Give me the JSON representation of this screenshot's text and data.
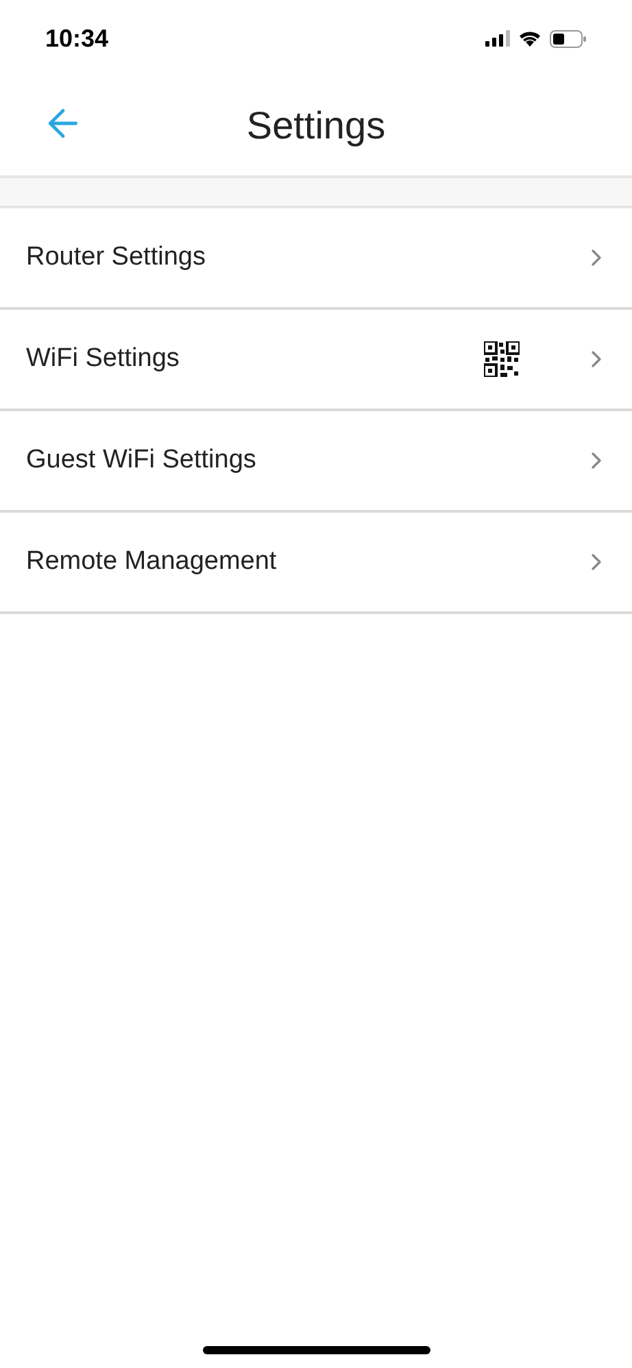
{
  "status_bar": {
    "time": "10:34"
  },
  "header": {
    "title": "Settings"
  },
  "items": [
    {
      "label": "Router Settings",
      "qr": false
    },
    {
      "label": "WiFi Settings",
      "qr": true
    },
    {
      "label": "Guest WiFi Settings",
      "qr": false
    },
    {
      "label": "Remote Management",
      "qr": false
    }
  ]
}
